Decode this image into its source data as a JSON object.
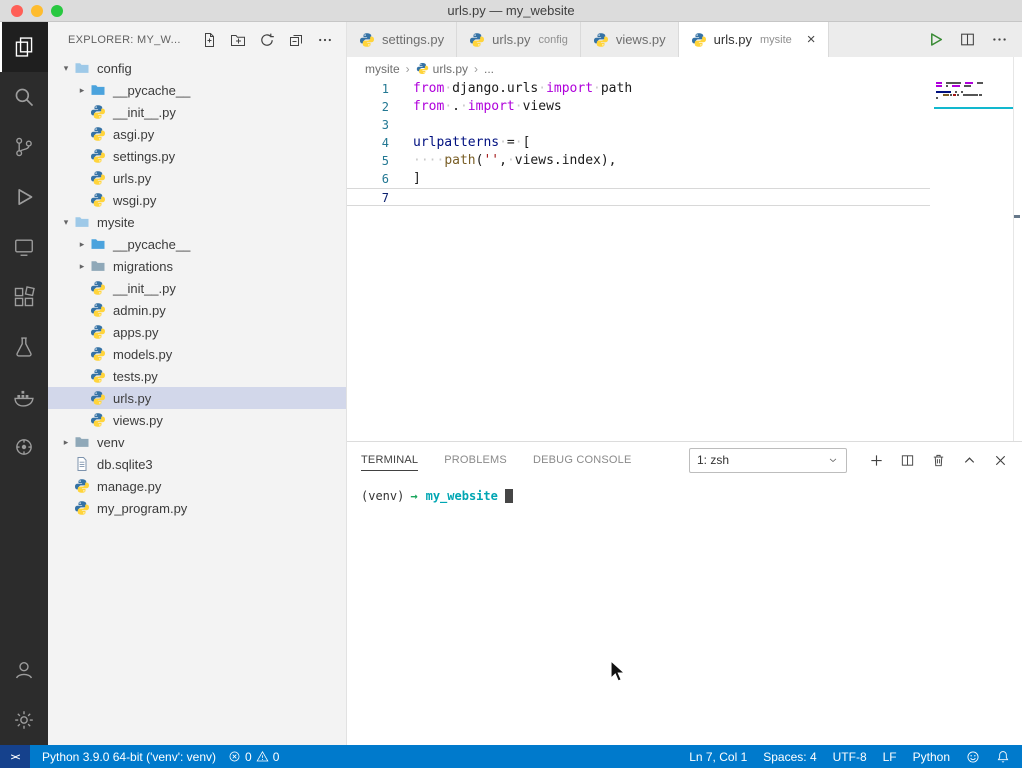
{
  "colors": {
    "accent": "#007acc",
    "activity_bar_bg": "#2c2c2c",
    "sidebar_bg": "#f3f3f3",
    "selection_bg": "#d2d7ea",
    "keyword": "#AF00DB",
    "string": "#A31515",
    "variable": "#001080",
    "function": "#795E26",
    "python_blue": "#3572A5",
    "python_yellow": "#FFD43B",
    "terminal_arrow_green": "#19a65c",
    "terminal_cwd_cyan": "#00A6B3",
    "remote_badge": "#15418c"
  },
  "titlebar": {
    "title": "urls.py — my_website"
  },
  "activity_bar": {
    "top": [
      {
        "name": "explorer",
        "active": true
      },
      {
        "name": "search"
      },
      {
        "name": "source-control"
      },
      {
        "name": "run-debug"
      },
      {
        "name": "remote-explorer"
      },
      {
        "name": "extensions"
      },
      {
        "name": "testing"
      },
      {
        "name": "docker"
      },
      {
        "name": "plugin"
      }
    ],
    "bottom": [
      {
        "name": "account"
      },
      {
        "name": "settings"
      }
    ]
  },
  "sidebar": {
    "title": "EXPLORER: MY_W...",
    "actions": [
      "new-file",
      "new-folder",
      "refresh",
      "collapse-all",
      "more"
    ],
    "tree": [
      {
        "label": "config",
        "indent": 0,
        "type": "folder",
        "expand": true,
        "color": "#9ec9e8"
      },
      {
        "label": "__pycache__",
        "indent": 1,
        "type": "folder",
        "expand": false,
        "color": "#4ba3dd"
      },
      {
        "label": "__init__.py",
        "indent": 1,
        "type": "python"
      },
      {
        "label": "asgi.py",
        "indent": 1,
        "type": "python"
      },
      {
        "label": "settings.py",
        "indent": 1,
        "type": "python"
      },
      {
        "label": "urls.py",
        "indent": 1,
        "type": "python"
      },
      {
        "label": "wsgi.py",
        "indent": 1,
        "type": "python"
      },
      {
        "label": "mysite",
        "indent": 0,
        "type": "folder",
        "expand": true,
        "color": "#9ec9e8"
      },
      {
        "label": "__pycache__",
        "indent": 1,
        "type": "folder",
        "expand": false,
        "color": "#4ba3dd"
      },
      {
        "label": "migrations",
        "indent": 1,
        "type": "folder",
        "expand": false,
        "color": "#8fa8b8"
      },
      {
        "label": "__init__.py",
        "indent": 1,
        "type": "python"
      },
      {
        "label": "admin.py",
        "indent": 1,
        "type": "python"
      },
      {
        "label": "apps.py",
        "indent": 1,
        "type": "python"
      },
      {
        "label": "models.py",
        "indent": 1,
        "type": "python"
      },
      {
        "label": "tests.py",
        "indent": 1,
        "type": "python"
      },
      {
        "label": "urls.py",
        "indent": 1,
        "type": "python",
        "selected": true
      },
      {
        "label": "views.py",
        "indent": 1,
        "type": "python"
      },
      {
        "label": "venv",
        "indent": 0,
        "type": "folder",
        "expand": false,
        "color": "#8fa8b8"
      },
      {
        "label": "db.sqlite3",
        "indent": 0,
        "type": "file"
      },
      {
        "label": "manage.py",
        "indent": 0,
        "type": "python"
      },
      {
        "label": "my_program.py",
        "indent": 0,
        "type": "python"
      }
    ]
  },
  "editor": {
    "tabs": [
      {
        "label": "settings.py",
        "detail": "",
        "active": false
      },
      {
        "label": "urls.py",
        "detail": "config",
        "active": false
      },
      {
        "label": "views.py",
        "detail": "",
        "active": false
      },
      {
        "label": "urls.py",
        "detail": "mysite",
        "active": true
      }
    ],
    "close_glyph": "×",
    "breadcrumb": [
      "mysite",
      "urls.py",
      "..."
    ],
    "code": {
      "current_line": 7,
      "lines": [
        {
          "n": 1,
          "tokens": [
            [
              "k",
              "from"
            ],
            [
              "w",
              "·"
            ],
            [
              "p",
              "django.urls"
            ],
            [
              "w",
              "·"
            ],
            [
              "k",
              "import"
            ],
            [
              "w",
              "·"
            ],
            [
              "p",
              "path"
            ]
          ]
        },
        {
          "n": 2,
          "tokens": [
            [
              "k",
              "from"
            ],
            [
              "w",
              "·"
            ],
            [
              "p",
              "."
            ],
            [
              "w",
              "·"
            ],
            [
              "k",
              "import"
            ],
            [
              "w",
              "·"
            ],
            [
              "p",
              "views"
            ]
          ]
        },
        {
          "n": 3,
          "tokens": []
        },
        {
          "n": 4,
          "tokens": [
            [
              "v",
              "urlpatterns"
            ],
            [
              "w",
              "·"
            ],
            [
              "o",
              "="
            ],
            [
              "w",
              "·"
            ],
            [
              "p",
              "["
            ]
          ]
        },
        {
          "n": 5,
          "tokens": [
            [
              "w",
              "····"
            ],
            [
              "f",
              "path"
            ],
            [
              "p",
              "("
            ],
            [
              "s",
              "''"
            ],
            [
              "p",
              ","
            ],
            [
              "w",
              "·"
            ],
            [
              "p",
              "views.index"
            ],
            [
              "p",
              "),"
            ]
          ]
        },
        {
          "n": 6,
          "tokens": [
            [
              "p",
              "]"
            ]
          ]
        },
        {
          "n": 7,
          "tokens": []
        }
      ]
    }
  },
  "panel": {
    "tabs": [
      {
        "label": "TERMINAL",
        "active": true
      },
      {
        "label": "PROBLEMS",
        "active": false
      },
      {
        "label": "DEBUG CONSOLE",
        "active": false
      }
    ],
    "shell_label": "1: zsh",
    "terminal": {
      "venv": "(venv)",
      "arrow": "→",
      "cwd": "my_website"
    }
  },
  "status_bar": {
    "remote_glyph": "><",
    "interpreter": "Python 3.9.0 64-bit ('venv': venv)",
    "errors": "0",
    "warnings": "0",
    "right": [
      "Ln 7, Col 1",
      "Spaces: 4",
      "UTF-8",
      "LF",
      "Python"
    ],
    "right_icons": [
      "feedback",
      "bell"
    ]
  }
}
